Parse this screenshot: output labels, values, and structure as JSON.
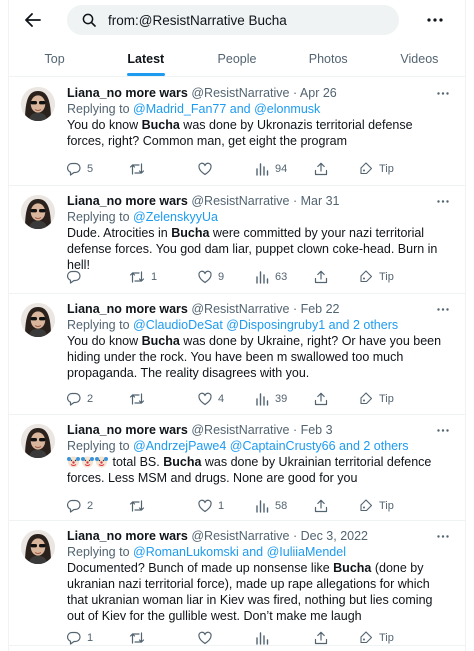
{
  "search": {
    "query": "from:@ResistNarrative Bucha"
  },
  "tabs": [
    {
      "label": "Top"
    },
    {
      "label": "Latest"
    },
    {
      "label": "People"
    },
    {
      "label": "Photos"
    },
    {
      "label": "Videos"
    }
  ],
  "tweets": [
    {
      "name": "Liana_no more wars",
      "handle": "@ResistNarrative · Apr 26",
      "replying_prefix": "Replying to ",
      "replying_users": "@Madrid_Fan77 and @elonmusk",
      "text_parts": [
        "You do know ",
        "Bucha",
        " was done by Ukronazis territorial defense forces, right? Common man, get eight the program"
      ],
      "replies": "5",
      "retweets": "",
      "likes": "",
      "views": "94",
      "tip": "Tip"
    },
    {
      "name": "Liana_no more wars",
      "handle": "@ResistNarrative · Mar 31",
      "replying_prefix": "Replying to ",
      "replying_users": "@ZelenskyyUa",
      "text_parts": [
        "Dude. Atrocities in ",
        "Bucha",
        " were committed by your nazi territorial defense forces. You god dam liar, puppet clown coke-head. Burn in hell!"
      ],
      "replies": "",
      "retweets": "1",
      "likes": "9",
      "views": "63",
      "tip": "Tip"
    },
    {
      "name": "Liana_no more wars",
      "handle": "@ResistNarrative · Feb 22",
      "replying_prefix": "Replying to ",
      "replying_users": "@ClaudioDeSat @Disposingruby1 and 2 others",
      "text_parts": [
        "You do know ",
        "Bucha",
        " was done by Ukraine, right? Or have you been hiding under the rock. You have been m swallowed too much propaganda. The reality disagrees with you."
      ],
      "replies": "2",
      "retweets": "",
      "likes": "4",
      "views": "39",
      "tip": "Tip"
    },
    {
      "name": "Liana_no more wars",
      "handle": "@ResistNarrative · Feb 3",
      "replying_prefix": "Replying to ",
      "replying_users": "@AndrzejPawe4 @CaptainCrusty66 and 2 others",
      "emoji_prefix": "🤡🤡🤡",
      "text_parts": [
        " total BS. ",
        "Bucha",
        " was done by Ukrainian territorial defence forces. Less MSM and drugs. None are good for you"
      ],
      "replies": "2",
      "retweets": "",
      "likes": "1",
      "views": "58",
      "tip": "Tip"
    },
    {
      "name": "Liana_no more wars",
      "handle": "@ResistNarrative · Dec 3, 2022",
      "replying_prefix": "Replying to ",
      "replying_users": "@RomanLukomski and @IuliiaMendel",
      "text_parts": [
        "Documented? Bunch of made up nonsense like ",
        "Bucha",
        " (done by ukranian nazi territorial force), made up rape allegations for which that ukranian woman liar in Kiev was fired, nothing but lies coming out of Kiev for the gullible west. Don’t make me laugh"
      ],
      "replies": "1",
      "retweets": "",
      "likes": "",
      "views": "",
      "tip": "Tip"
    }
  ]
}
